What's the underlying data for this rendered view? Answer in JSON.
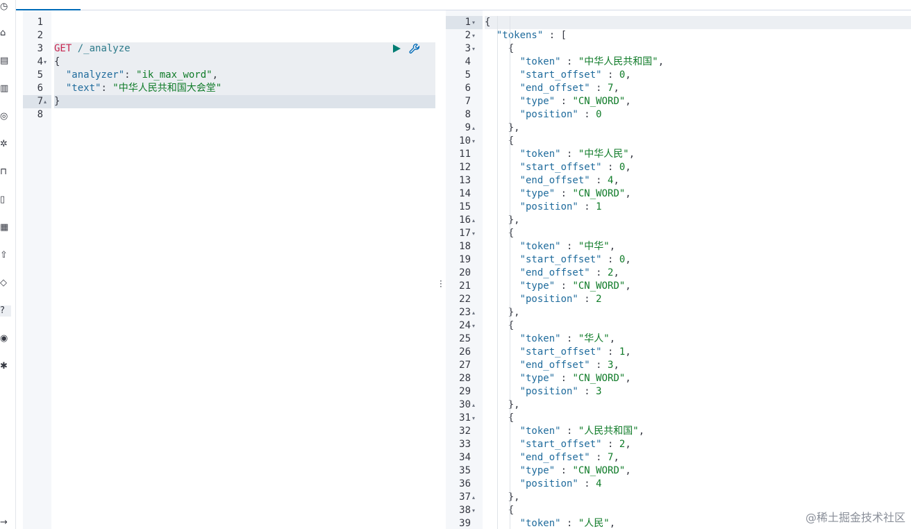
{
  "sidebar": {
    "icons": [
      "clock-icon",
      "home-icon",
      "dashboard-icon",
      "building-icon",
      "user-icon",
      "settings-icon",
      "lock-icon",
      "document-icon",
      "grid-icon",
      "upload-icon",
      "shield-icon",
      "help-icon",
      "graph-icon",
      "gear-icon",
      "arrow-icon"
    ],
    "active_index": 11
  },
  "request_editor": {
    "lines": [
      {
        "num": "1",
        "fold": "",
        "tokens": []
      },
      {
        "num": "2",
        "fold": "",
        "tokens": []
      },
      {
        "num": "3",
        "fold": "",
        "tokens": [
          {
            "t": "GET",
            "c": "method"
          },
          {
            "t": " /_analyze",
            "c": "path"
          }
        ]
      },
      {
        "num": "4",
        "fold": "▾",
        "tokens": [
          {
            "t": "{",
            "c": "punct"
          }
        ]
      },
      {
        "num": "5",
        "fold": "",
        "tokens": [
          {
            "t": "  \"analyzer\"",
            "c": "key"
          },
          {
            "t": ": ",
            "c": "punct"
          },
          {
            "t": "\"ik_max_word\"",
            "c": "str"
          },
          {
            "t": ",",
            "c": "punct"
          }
        ]
      },
      {
        "num": "6",
        "fold": "",
        "tokens": [
          {
            "t": "  \"text\"",
            "c": "key"
          },
          {
            "t": ": ",
            "c": "punct"
          },
          {
            "t": "\"中华人民共和国大会堂\"",
            "c": "str"
          }
        ]
      },
      {
        "num": "7",
        "fold": "▴",
        "tokens": [
          {
            "t": "}",
            "c": "punct"
          }
        ]
      },
      {
        "num": "8",
        "fold": "",
        "tokens": []
      }
    ],
    "request_block_lines": [
      3,
      4,
      5,
      6
    ],
    "cursor_line": 7
  },
  "response_viewer": {
    "lines": [
      {
        "num": "1",
        "fold": "▾",
        "tokens": [
          {
            "t": "{",
            "c": "punct"
          }
        ]
      },
      {
        "num": "2",
        "fold": "▾",
        "tokens": [
          {
            "t": "  \"tokens\"",
            "c": "key"
          },
          {
            "t": " : [",
            "c": "punct"
          }
        ]
      },
      {
        "num": "3",
        "fold": "▾",
        "tokens": [
          {
            "t": "    {",
            "c": "punct"
          }
        ]
      },
      {
        "num": "4",
        "fold": "",
        "tokens": [
          {
            "t": "      \"token\"",
            "c": "key"
          },
          {
            "t": " : ",
            "c": "punct"
          },
          {
            "t": "\"中华人民共和国\"",
            "c": "str"
          },
          {
            "t": ",",
            "c": "punct"
          }
        ]
      },
      {
        "num": "5",
        "fold": "",
        "tokens": [
          {
            "t": "      \"start_offset\"",
            "c": "key"
          },
          {
            "t": " : ",
            "c": "punct"
          },
          {
            "t": "0",
            "c": "num"
          },
          {
            "t": ",",
            "c": "punct"
          }
        ]
      },
      {
        "num": "6",
        "fold": "",
        "tokens": [
          {
            "t": "      \"end_offset\"",
            "c": "key"
          },
          {
            "t": " : ",
            "c": "punct"
          },
          {
            "t": "7",
            "c": "num"
          },
          {
            "t": ",",
            "c": "punct"
          }
        ]
      },
      {
        "num": "7",
        "fold": "",
        "tokens": [
          {
            "t": "      \"type\"",
            "c": "key"
          },
          {
            "t": " : ",
            "c": "punct"
          },
          {
            "t": "\"CN_WORD\"",
            "c": "str"
          },
          {
            "t": ",",
            "c": "punct"
          }
        ]
      },
      {
        "num": "8",
        "fold": "",
        "tokens": [
          {
            "t": "      \"position\"",
            "c": "key"
          },
          {
            "t": " : ",
            "c": "punct"
          },
          {
            "t": "0",
            "c": "num"
          }
        ]
      },
      {
        "num": "9",
        "fold": "▴",
        "tokens": [
          {
            "t": "    },",
            "c": "punct"
          }
        ]
      },
      {
        "num": "10",
        "fold": "▾",
        "tokens": [
          {
            "t": "    {",
            "c": "punct"
          }
        ]
      },
      {
        "num": "11",
        "fold": "",
        "tokens": [
          {
            "t": "      \"token\"",
            "c": "key"
          },
          {
            "t": " : ",
            "c": "punct"
          },
          {
            "t": "\"中华人民\"",
            "c": "str"
          },
          {
            "t": ",",
            "c": "punct"
          }
        ]
      },
      {
        "num": "12",
        "fold": "",
        "tokens": [
          {
            "t": "      \"start_offset\"",
            "c": "key"
          },
          {
            "t": " : ",
            "c": "punct"
          },
          {
            "t": "0",
            "c": "num"
          },
          {
            "t": ",",
            "c": "punct"
          }
        ]
      },
      {
        "num": "13",
        "fold": "",
        "tokens": [
          {
            "t": "      \"end_offset\"",
            "c": "key"
          },
          {
            "t": " : ",
            "c": "punct"
          },
          {
            "t": "4",
            "c": "num"
          },
          {
            "t": ",",
            "c": "punct"
          }
        ]
      },
      {
        "num": "14",
        "fold": "",
        "tokens": [
          {
            "t": "      \"type\"",
            "c": "key"
          },
          {
            "t": " : ",
            "c": "punct"
          },
          {
            "t": "\"CN_WORD\"",
            "c": "str"
          },
          {
            "t": ",",
            "c": "punct"
          }
        ]
      },
      {
        "num": "15",
        "fold": "",
        "tokens": [
          {
            "t": "      \"position\"",
            "c": "key"
          },
          {
            "t": " : ",
            "c": "punct"
          },
          {
            "t": "1",
            "c": "num"
          }
        ]
      },
      {
        "num": "16",
        "fold": "▴",
        "tokens": [
          {
            "t": "    },",
            "c": "punct"
          }
        ]
      },
      {
        "num": "17",
        "fold": "▾",
        "tokens": [
          {
            "t": "    {",
            "c": "punct"
          }
        ]
      },
      {
        "num": "18",
        "fold": "",
        "tokens": [
          {
            "t": "      \"token\"",
            "c": "key"
          },
          {
            "t": " : ",
            "c": "punct"
          },
          {
            "t": "\"中华\"",
            "c": "str"
          },
          {
            "t": ",",
            "c": "punct"
          }
        ]
      },
      {
        "num": "19",
        "fold": "",
        "tokens": [
          {
            "t": "      \"start_offset\"",
            "c": "key"
          },
          {
            "t": " : ",
            "c": "punct"
          },
          {
            "t": "0",
            "c": "num"
          },
          {
            "t": ",",
            "c": "punct"
          }
        ]
      },
      {
        "num": "20",
        "fold": "",
        "tokens": [
          {
            "t": "      \"end_offset\"",
            "c": "key"
          },
          {
            "t": " : ",
            "c": "punct"
          },
          {
            "t": "2",
            "c": "num"
          },
          {
            "t": ",",
            "c": "punct"
          }
        ]
      },
      {
        "num": "21",
        "fold": "",
        "tokens": [
          {
            "t": "      \"type\"",
            "c": "key"
          },
          {
            "t": " : ",
            "c": "punct"
          },
          {
            "t": "\"CN_WORD\"",
            "c": "str"
          },
          {
            "t": ",",
            "c": "punct"
          }
        ]
      },
      {
        "num": "22",
        "fold": "",
        "tokens": [
          {
            "t": "      \"position\"",
            "c": "key"
          },
          {
            "t": " : ",
            "c": "punct"
          },
          {
            "t": "2",
            "c": "num"
          }
        ]
      },
      {
        "num": "23",
        "fold": "▴",
        "tokens": [
          {
            "t": "    },",
            "c": "punct"
          }
        ]
      },
      {
        "num": "24",
        "fold": "▾",
        "tokens": [
          {
            "t": "    {",
            "c": "punct"
          }
        ]
      },
      {
        "num": "25",
        "fold": "",
        "tokens": [
          {
            "t": "      \"token\"",
            "c": "key"
          },
          {
            "t": " : ",
            "c": "punct"
          },
          {
            "t": "\"华人\"",
            "c": "str"
          },
          {
            "t": ",",
            "c": "punct"
          }
        ]
      },
      {
        "num": "26",
        "fold": "",
        "tokens": [
          {
            "t": "      \"start_offset\"",
            "c": "key"
          },
          {
            "t": " : ",
            "c": "punct"
          },
          {
            "t": "1",
            "c": "num"
          },
          {
            "t": ",",
            "c": "punct"
          }
        ]
      },
      {
        "num": "27",
        "fold": "",
        "tokens": [
          {
            "t": "      \"end_offset\"",
            "c": "key"
          },
          {
            "t": " : ",
            "c": "punct"
          },
          {
            "t": "3",
            "c": "num"
          },
          {
            "t": ",",
            "c": "punct"
          }
        ]
      },
      {
        "num": "28",
        "fold": "",
        "tokens": [
          {
            "t": "      \"type\"",
            "c": "key"
          },
          {
            "t": " : ",
            "c": "punct"
          },
          {
            "t": "\"CN_WORD\"",
            "c": "str"
          },
          {
            "t": ",",
            "c": "punct"
          }
        ]
      },
      {
        "num": "29",
        "fold": "",
        "tokens": [
          {
            "t": "      \"position\"",
            "c": "key"
          },
          {
            "t": " : ",
            "c": "punct"
          },
          {
            "t": "3",
            "c": "num"
          }
        ]
      },
      {
        "num": "30",
        "fold": "▴",
        "tokens": [
          {
            "t": "    },",
            "c": "punct"
          }
        ]
      },
      {
        "num": "31",
        "fold": "▾",
        "tokens": [
          {
            "t": "    {",
            "c": "punct"
          }
        ]
      },
      {
        "num": "32",
        "fold": "",
        "tokens": [
          {
            "t": "      \"token\"",
            "c": "key"
          },
          {
            "t": " : ",
            "c": "punct"
          },
          {
            "t": "\"人民共和国\"",
            "c": "str"
          },
          {
            "t": ",",
            "c": "punct"
          }
        ]
      },
      {
        "num": "33",
        "fold": "",
        "tokens": [
          {
            "t": "      \"start_offset\"",
            "c": "key"
          },
          {
            "t": " : ",
            "c": "punct"
          },
          {
            "t": "2",
            "c": "num"
          },
          {
            "t": ",",
            "c": "punct"
          }
        ]
      },
      {
        "num": "34",
        "fold": "",
        "tokens": [
          {
            "t": "      \"end_offset\"",
            "c": "key"
          },
          {
            "t": " : ",
            "c": "punct"
          },
          {
            "t": "7",
            "c": "num"
          },
          {
            "t": ",",
            "c": "punct"
          }
        ]
      },
      {
        "num": "35",
        "fold": "",
        "tokens": [
          {
            "t": "      \"type\"",
            "c": "key"
          },
          {
            "t": " : ",
            "c": "punct"
          },
          {
            "t": "\"CN_WORD\"",
            "c": "str"
          },
          {
            "t": ",",
            "c": "punct"
          }
        ]
      },
      {
        "num": "36",
        "fold": "",
        "tokens": [
          {
            "t": "      \"position\"",
            "c": "key"
          },
          {
            "t": " : ",
            "c": "punct"
          },
          {
            "t": "4",
            "c": "num"
          }
        ]
      },
      {
        "num": "37",
        "fold": "▴",
        "tokens": [
          {
            "t": "    },",
            "c": "punct"
          }
        ]
      },
      {
        "num": "38",
        "fold": "▾",
        "tokens": [
          {
            "t": "    {",
            "c": "punct"
          }
        ]
      },
      {
        "num": "39",
        "fold": "",
        "tokens": [
          {
            "t": "      \"token\"",
            "c": "key"
          },
          {
            "t": " : ",
            "c": "punct"
          },
          {
            "t": "\"人民\"",
            "c": "str"
          },
          {
            "t": ",",
            "c": "punct"
          }
        ]
      }
    ],
    "cursor_line": 1
  },
  "watermark": "@稀土掘金技术社区",
  "colors": {
    "method": "#c7254e",
    "key": "#1f6b9c",
    "string": "#0f7b28",
    "run_button": "#017d73",
    "accent": "#006bb8"
  }
}
